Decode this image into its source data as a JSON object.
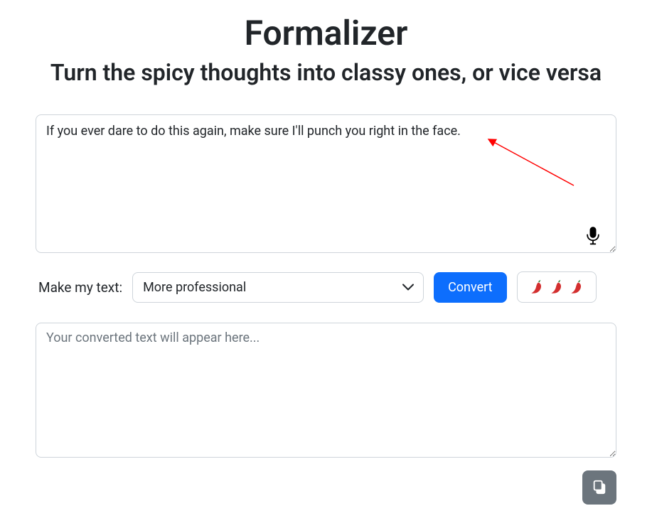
{
  "header": {
    "title": "Formalizer",
    "subtitle": "Turn the spicy thoughts into classy ones, or vice versa"
  },
  "input": {
    "value": "If you ever dare to do this again, make sure I'll punch you right in the face.",
    "placeholder": ""
  },
  "controls": {
    "label": "Make my text:",
    "selected": "More professional",
    "convert_label": "Convert",
    "spicy_emoji": "🌶️"
  },
  "output": {
    "value": "",
    "placeholder": "Your converted text will appear here..."
  }
}
